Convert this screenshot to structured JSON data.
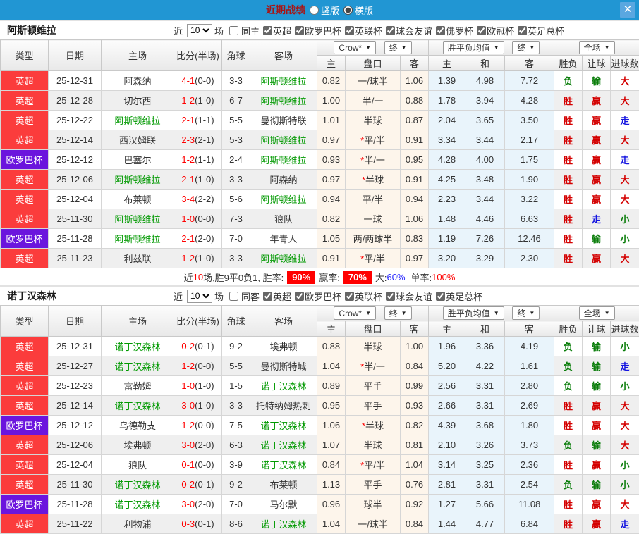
{
  "colors": {
    "titlebar_blue": "#2196d3",
    "title_red": "#a81414",
    "league_red": "#fb3c3c",
    "league_purple": "#6b15dd",
    "focal_green": "#009900",
    "win_red": "#d40000",
    "lose_green": "#0a7d0a",
    "push_blue": "#1414e0",
    "crow_bg": "#fdf5eb",
    "avg_bg": "#e9f4fb"
  },
  "titlebar": {
    "title": "近期战绩",
    "radio_vertical": "竖版",
    "radio_horizontal": "横版",
    "close": "✕"
  },
  "table_header": {
    "col_type": "类型",
    "col_date": "日期",
    "col_home": "主场",
    "col_score": "比分(半场)",
    "col_corner": "角球",
    "col_away": "客场",
    "crow_dropdown": "Crow*",
    "final_dropdown": "终",
    "avg_dropdown": "胜平负均值",
    "final_dropdown2": "终",
    "fulltime_dropdown": "全场",
    "sub_home": "主",
    "sub_handicap": "盘口",
    "sub_away": "客",
    "sub_avg_home": "主",
    "sub_avg_draw": "和",
    "sub_avg_away": "客",
    "col_wl": "胜负",
    "col_let": "让球",
    "col_goals": "进球数",
    "caret": "▼"
  },
  "sections": [
    {
      "team": "阿斯顿维拉",
      "filter": {
        "near": "近",
        "count": "10",
        "games": "场",
        "same_label": "同主",
        "leagues": [
          "英超",
          "欧罗巴杯",
          "英联杯",
          "球会友谊",
          "佛罗杯",
          "欧冠杯",
          "英足总杯"
        ]
      },
      "rows": [
        {
          "league": "英超",
          "league_color": "red",
          "date": "25-12-31",
          "home": "阿森纳",
          "home_focal": false,
          "score": "4-1",
          "half": "(0-0)",
          "corner": "3-3",
          "away": "阿斯顿维拉",
          "away_focal": true,
          "crow_home": "0.82",
          "handicap": "一/球半",
          "crow_away": "1.06",
          "avg_home": "1.39",
          "avg_draw": "4.98",
          "avg_away": "7.72",
          "wl": "负",
          "hr": "输",
          "goals": "大"
        },
        {
          "league": "英超",
          "league_color": "red",
          "date": "25-12-28",
          "home": "切尔西",
          "home_focal": false,
          "score": "1-2",
          "half": "(1-0)",
          "corner": "6-7",
          "away": "阿斯顿维拉",
          "away_focal": true,
          "crow_home": "1.00",
          "handicap": "半/一",
          "crow_away": "0.88",
          "avg_home": "1.78",
          "avg_draw": "3.94",
          "avg_away": "4.28",
          "wl": "胜",
          "hr": "赢",
          "goals": "大"
        },
        {
          "league": "英超",
          "league_color": "red",
          "date": "25-12-22",
          "home": "阿斯顿维拉",
          "home_focal": true,
          "score": "2-1",
          "half": "(1-1)",
          "corner": "5-5",
          "away": "曼彻斯特联",
          "away_focal": false,
          "crow_home": "1.01",
          "handicap": "半球",
          "crow_away": "0.87",
          "avg_home": "2.04",
          "avg_draw": "3.65",
          "avg_away": "3.50",
          "wl": "胜",
          "hr": "赢",
          "goals": "走"
        },
        {
          "league": "英超",
          "league_color": "red",
          "date": "25-12-14",
          "home": "西汉姆联",
          "home_focal": false,
          "score": "2-3",
          "half": "(2-1)",
          "corner": "5-3",
          "away": "阿斯顿维拉",
          "away_focal": true,
          "crow_home": "0.97",
          "handicap": "*平/半",
          "crow_away": "0.91",
          "avg_home": "3.34",
          "avg_draw": "3.44",
          "avg_away": "2.17",
          "wl": "胜",
          "hr": "赢",
          "goals": "大"
        },
        {
          "league": "欧罗巴杯",
          "league_color": "purple",
          "date": "25-12-12",
          "home": "巴塞尔",
          "home_focal": false,
          "score": "1-2",
          "half": "(1-1)",
          "corner": "2-4",
          "away": "阿斯顿维拉",
          "away_focal": true,
          "crow_home": "0.93",
          "handicap": "*半/一",
          "crow_away": "0.95",
          "avg_home": "4.28",
          "avg_draw": "4.00",
          "avg_away": "1.75",
          "wl": "胜",
          "hr": "赢",
          "goals": "走"
        },
        {
          "league": "英超",
          "league_color": "red",
          "date": "25-12-06",
          "home": "阿斯顿维拉",
          "home_focal": true,
          "score": "2-1",
          "half": "(1-0)",
          "corner": "3-3",
          "away": "阿森纳",
          "away_focal": false,
          "crow_home": "0.97",
          "handicap": "*半球",
          "crow_away": "0.91",
          "avg_home": "4.25",
          "avg_draw": "3.48",
          "avg_away": "1.90",
          "wl": "胜",
          "hr": "赢",
          "goals": "大"
        },
        {
          "league": "英超",
          "league_color": "red",
          "date": "25-12-04",
          "home": "布莱顿",
          "home_focal": false,
          "score": "3-4",
          "half": "(2-2)",
          "corner": "5-6",
          "away": "阿斯顿维拉",
          "away_focal": true,
          "crow_home": "0.94",
          "handicap": "平/半",
          "crow_away": "0.94",
          "avg_home": "2.23",
          "avg_draw": "3.44",
          "avg_away": "3.22",
          "wl": "胜",
          "hr": "赢",
          "goals": "大"
        },
        {
          "league": "英超",
          "league_color": "red",
          "date": "25-11-30",
          "home": "阿斯顿维拉",
          "home_focal": true,
          "score": "1-0",
          "half": "(0-0)",
          "corner": "7-3",
          "away": "狼队",
          "away_focal": false,
          "crow_home": "0.82",
          "handicap": "一球",
          "crow_away": "1.06",
          "avg_home": "1.48",
          "avg_draw": "4.46",
          "avg_away": "6.63",
          "wl": "胜",
          "hr": "走",
          "goals": "小"
        },
        {
          "league": "欧罗巴杯",
          "league_color": "purple",
          "date": "25-11-28",
          "home": "阿斯顿维拉",
          "home_focal": true,
          "score": "2-1",
          "half": "(2-0)",
          "corner": "7-0",
          "away": "年青人",
          "away_focal": false,
          "crow_home": "1.05",
          "handicap": "两/两球半",
          "crow_away": "0.83",
          "avg_home": "1.19",
          "avg_draw": "7.26",
          "avg_away": "12.46",
          "wl": "胜",
          "hr": "输",
          "goals": "小"
        },
        {
          "league": "英超",
          "league_color": "red",
          "date": "25-11-23",
          "home": "利兹联",
          "home_focal": false,
          "score": "1-2",
          "half": "(1-0)",
          "corner": "3-3",
          "away": "阿斯顿维拉",
          "away_focal": true,
          "crow_home": "0.91",
          "handicap": "*平/半",
          "crow_away": "0.97",
          "avg_home": "3.20",
          "avg_draw": "3.29",
          "avg_away": "2.30",
          "wl": "胜",
          "hr": "赢",
          "goals": "大"
        }
      ],
      "summary": {
        "part1": "近",
        "num": "10",
        "part2": "场,胜9平0负1, 胜率:",
        "win": "90%",
        "part3": "赢率:",
        "earn": "70%",
        "part4": "大:",
        "big": "60%",
        "part5": "单率:",
        "single": "100%"
      }
    },
    {
      "team": "诺丁汉森林",
      "filter": {
        "near": "近",
        "count": "10",
        "games": "场",
        "same_label": "同客",
        "leagues": [
          "英超",
          "欧罗巴杯",
          "英联杯",
          "球会友谊",
          "英足总杯"
        ]
      },
      "rows": [
        {
          "league": "英超",
          "league_color": "red",
          "date": "25-12-31",
          "home": "诺丁汉森林",
          "home_focal": true,
          "score": "0-2",
          "half": "(0-1)",
          "corner": "9-2",
          "away": "埃弗顿",
          "away_focal": false,
          "crow_home": "0.88",
          "handicap": "半球",
          "crow_away": "1.00",
          "avg_home": "1.96",
          "avg_draw": "3.36",
          "avg_away": "4.19",
          "wl": "负",
          "hr": "输",
          "goals": "小"
        },
        {
          "league": "英超",
          "league_color": "red",
          "date": "25-12-27",
          "home": "诺丁汉森林",
          "home_focal": true,
          "score": "1-2",
          "half": "(0-0)",
          "corner": "5-5",
          "away": "曼彻斯特城",
          "away_focal": false,
          "crow_home": "1.04",
          "handicap": "*半/一",
          "crow_away": "0.84",
          "avg_home": "5.20",
          "avg_draw": "4.22",
          "avg_away": "1.61",
          "wl": "负",
          "hr": "输",
          "goals": "走"
        },
        {
          "league": "英超",
          "league_color": "red",
          "date": "25-12-23",
          "home": "富勒姆",
          "home_focal": false,
          "score": "1-0",
          "half": "(1-0)",
          "corner": "1-5",
          "away": "诺丁汉森林",
          "away_focal": true,
          "crow_home": "0.89",
          "handicap": "平手",
          "crow_away": "0.99",
          "avg_home": "2.56",
          "avg_draw": "3.31",
          "avg_away": "2.80",
          "wl": "负",
          "hr": "输",
          "goals": "小"
        },
        {
          "league": "英超",
          "league_color": "red",
          "date": "25-12-14",
          "home": "诺丁汉森林",
          "home_focal": true,
          "score": "3-0",
          "half": "(1-0)",
          "corner": "3-3",
          "away": "托特纳姆热刺",
          "away_focal": false,
          "crow_home": "0.95",
          "handicap": "平手",
          "crow_away": "0.93",
          "avg_home": "2.66",
          "avg_draw": "3.31",
          "avg_away": "2.69",
          "wl": "胜",
          "hr": "赢",
          "goals": "大"
        },
        {
          "league": "欧罗巴杯",
          "league_color": "purple",
          "date": "25-12-12",
          "home": "乌德勒支",
          "home_focal": false,
          "score": "1-2",
          "half": "(0-0)",
          "corner": "7-5",
          "away": "诺丁汉森林",
          "away_focal": true,
          "crow_home": "1.06",
          "handicap": "*半球",
          "crow_away": "0.82",
          "avg_home": "4.39",
          "avg_draw": "3.68",
          "avg_away": "1.80",
          "wl": "胜",
          "hr": "赢",
          "goals": "大"
        },
        {
          "league": "英超",
          "league_color": "red",
          "date": "25-12-06",
          "home": "埃弗顿",
          "home_focal": false,
          "score": "3-0",
          "half": "(2-0)",
          "corner": "6-3",
          "away": "诺丁汉森林",
          "away_focal": true,
          "crow_home": "1.07",
          "handicap": "半球",
          "crow_away": "0.81",
          "avg_home": "2.10",
          "avg_draw": "3.26",
          "avg_away": "3.73",
          "wl": "负",
          "hr": "输",
          "goals": "大"
        },
        {
          "league": "英超",
          "league_color": "red",
          "date": "25-12-04",
          "home": "狼队",
          "home_focal": false,
          "score": "0-1",
          "half": "(0-0)",
          "corner": "3-9",
          "away": "诺丁汉森林",
          "away_focal": true,
          "crow_home": "0.84",
          "handicap": "*平/半",
          "crow_away": "1.04",
          "avg_home": "3.14",
          "avg_draw": "3.25",
          "avg_away": "2.36",
          "wl": "胜",
          "hr": "赢",
          "goals": "小"
        },
        {
          "league": "英超",
          "league_color": "red",
          "date": "25-11-30",
          "home": "诺丁汉森林",
          "home_focal": true,
          "score": "0-2",
          "half": "(0-1)",
          "corner": "9-2",
          "away": "布莱顿",
          "away_focal": false,
          "crow_home": "1.13",
          "handicap": "平手",
          "crow_away": "0.76",
          "avg_home": "2.81",
          "avg_draw": "3.31",
          "avg_away": "2.54",
          "wl": "负",
          "hr": "输",
          "goals": "小"
        },
        {
          "league": "欧罗巴杯",
          "league_color": "purple",
          "date": "25-11-28",
          "home": "诺丁汉森林",
          "home_focal": true,
          "score": "3-0",
          "half": "(2-0)",
          "corner": "7-0",
          "away": "马尔默",
          "away_focal": false,
          "crow_home": "0.96",
          "handicap": "球半",
          "crow_away": "0.92",
          "avg_home": "1.27",
          "avg_draw": "5.66",
          "avg_away": "11.08",
          "wl": "胜",
          "hr": "赢",
          "goals": "大"
        },
        {
          "league": "英超",
          "league_color": "red",
          "date": "25-11-22",
          "home": "利物浦",
          "home_focal": false,
          "score": "0-3",
          "half": "(0-1)",
          "corner": "8-6",
          "away": "诺丁汉森林",
          "away_focal": true,
          "crow_home": "1.04",
          "handicap": "一/球半",
          "crow_away": "0.84",
          "avg_home": "1.44",
          "avg_draw": "4.77",
          "avg_away": "6.84",
          "wl": "胜",
          "hr": "赢",
          "goals": "走"
        }
      ]
    }
  ]
}
